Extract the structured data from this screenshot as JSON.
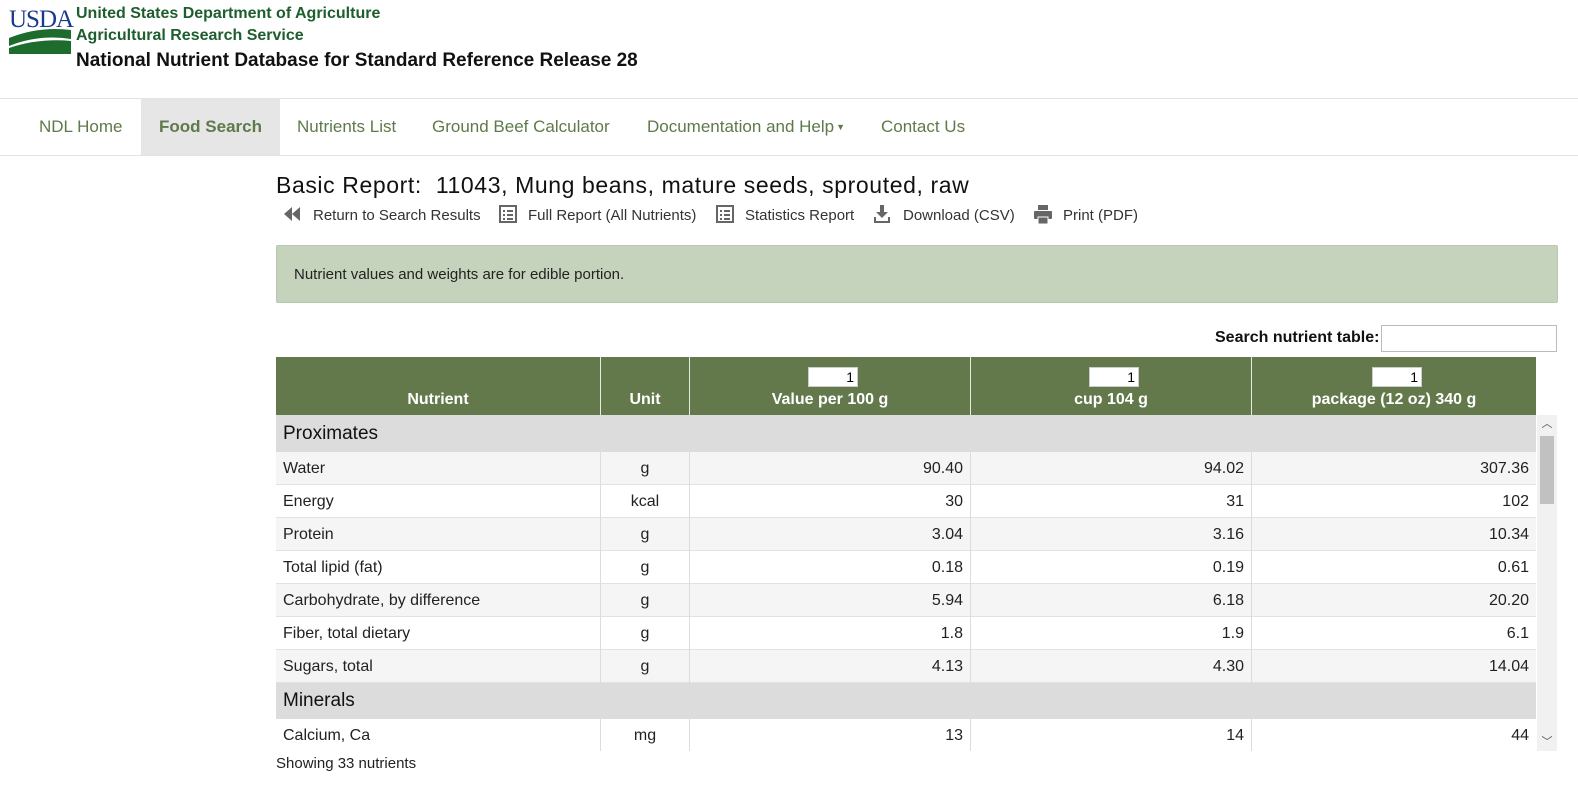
{
  "header": {
    "logo_text": "USDA",
    "org_line1": "United States Department of Agriculture",
    "org_line2": "Agricultural Research Service",
    "db_title": "National Nutrient Database for Standard Reference Release 28"
  },
  "nav": {
    "items": [
      {
        "label": "NDL Home",
        "active": false
      },
      {
        "label": "Food Search",
        "active": true
      },
      {
        "label": "Nutrients List",
        "active": false
      },
      {
        "label": "Ground Beef Calculator",
        "active": false
      },
      {
        "label": "Documentation and Help",
        "active": false,
        "dropdown": true
      },
      {
        "label": "Contact Us",
        "active": false
      }
    ]
  },
  "report": {
    "title": "Basic Report:  11043, Mung beans, mature seeds, sprouted, raw",
    "actions": [
      {
        "label": "Return to Search Results",
        "icon": "double-chevron-left-icon"
      },
      {
        "label": "Full Report (All Nutrients)",
        "icon": "list-icon"
      },
      {
        "label": "Statistics Report",
        "icon": "list-icon"
      },
      {
        "label": "Download (CSV)",
        "icon": "download-icon"
      },
      {
        "label": "Print (PDF)",
        "icon": "print-icon"
      }
    ],
    "notice": "Nutrient values and weights are for edible portion.",
    "search_label": "Search nutrient table:",
    "search_value": ""
  },
  "table": {
    "headers": {
      "nutrient": "Nutrient",
      "unit": "Unit",
      "col1": "Value per 100 g",
      "col2": "cup 104 g",
      "col3": "package (12 oz) 340 g"
    },
    "qty_inputs": [
      "1",
      "1",
      "1"
    ],
    "groups": [
      {
        "name": "Proximates",
        "rows": [
          {
            "nutrient": "Water",
            "unit": "g",
            "v1": "90.40",
            "v2": "94.02",
            "v3": "307.36"
          },
          {
            "nutrient": "Energy",
            "unit": "kcal",
            "v1": "30",
            "v2": "31",
            "v3": "102"
          },
          {
            "nutrient": "Protein",
            "unit": "g",
            "v1": "3.04",
            "v2": "3.16",
            "v3": "10.34"
          },
          {
            "nutrient": "Total lipid (fat)",
            "unit": "g",
            "v1": "0.18",
            "v2": "0.19",
            "v3": "0.61"
          },
          {
            "nutrient": "Carbohydrate, by difference",
            "unit": "g",
            "v1": "5.94",
            "v2": "6.18",
            "v3": "20.20"
          },
          {
            "nutrient": "Fiber, total dietary",
            "unit": "g",
            "v1": "1.8",
            "v2": "1.9",
            "v3": "6.1"
          },
          {
            "nutrient": "Sugars, total",
            "unit": "g",
            "v1": "4.13",
            "v2": "4.30",
            "v3": "14.04"
          }
        ]
      },
      {
        "name": "Minerals",
        "rows": [
          {
            "nutrient": "Calcium, Ca",
            "unit": "mg",
            "v1": "13",
            "v2": "14",
            "v3": "44"
          }
        ]
      }
    ],
    "footer": "Showing 33 nutrients"
  }
}
